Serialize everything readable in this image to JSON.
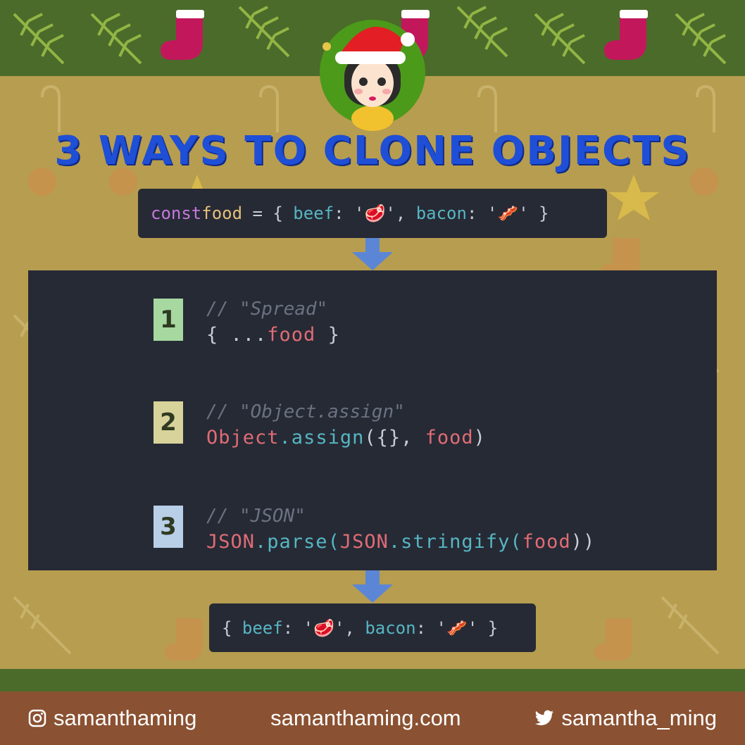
{
  "title": "3 WAYS TO CLONE OBJECTS",
  "top_code": {
    "kw": "const",
    "var": "food",
    "eq": " = { ",
    "k1": "beef",
    "c1": ": '",
    "e1": "🥩",
    "c2": "', ",
    "k2": "bacon",
    "c3": ": '",
    "e2": "🥓",
    "c4": "' }"
  },
  "methods": [
    {
      "number": "1",
      "comment": "// \"Spread\"",
      "code_a": "{ ...",
      "code_b": "food",
      "code_c": " }"
    },
    {
      "number": "2",
      "comment": "// \"Object.assign\"",
      "code_a": "Object",
      "code_b": ".assign",
      "code_c": "({}, ",
      "code_d": "food",
      "code_e": ")"
    },
    {
      "number": "3",
      "comment": "// \"JSON\"",
      "code_a": "JSON",
      "code_b": ".parse(",
      "code_c": "JSON",
      "code_d": ".stringify(",
      "code_e": "food",
      "code_f": "))"
    }
  ],
  "result_code": {
    "open": "{ ",
    "k1": "beef",
    "c1": ": '",
    "e1": "🥩",
    "c2": "', ",
    "k2": "bacon",
    "c3": ": '",
    "e2": "🥓",
    "c4": "' }"
  },
  "footer": {
    "instagram": "samanthaming",
    "website": "samanthaming.com",
    "twitter": "samantha_ming"
  },
  "colors": {
    "badge1": "#a6d8a0",
    "badge2": "#d7d39a",
    "badge3": "#b9cfe7",
    "arrow": "#5b86d6",
    "title": "#1f4fd6"
  }
}
